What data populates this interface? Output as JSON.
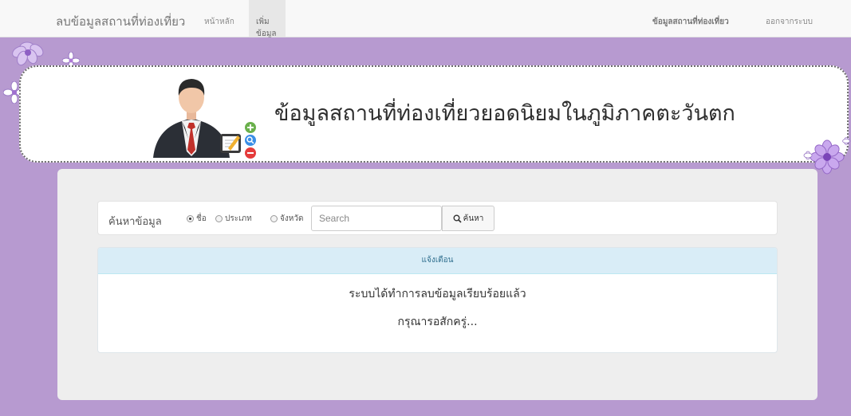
{
  "navbar": {
    "brand": "ลบข้อมูลสถานที่ท่องเที่ยว",
    "links": [
      "หน้าหลัก",
      "เพิ่มข้อมูล"
    ],
    "right_links": [
      "ข้อมูลสถานที่ท่องเที่ยว",
      "ออกจากระบบ"
    ]
  },
  "banner": {
    "title": "ข้อมูลสถานที่ท่องเที่ยวยอดนิยมในภูมิภาคตะวันตก"
  },
  "search": {
    "label": "ค้นหาข้อมูล",
    "options": [
      "ชื่อ",
      "ประเภท",
      "จังหวัด"
    ],
    "selected": "ชื่อ",
    "placeholder": "Search",
    "button_label": "ค้นหา"
  },
  "alert": {
    "heading": "แจ้งเตือน",
    "message": "ระบบได้ทำการลบข้อมูลเรียบร้อยแล้ว",
    "submessage": "กรุณารอสักครู่..."
  },
  "colors": {
    "background_purple": "#b79ad0",
    "alert_heading_bg": "#d9edf7",
    "alert_heading_text": "#31708f",
    "navbar_bg": "#f8f8f8"
  },
  "icons": [
    "search-icon",
    "user-avatar-icon",
    "flower-icon"
  ]
}
